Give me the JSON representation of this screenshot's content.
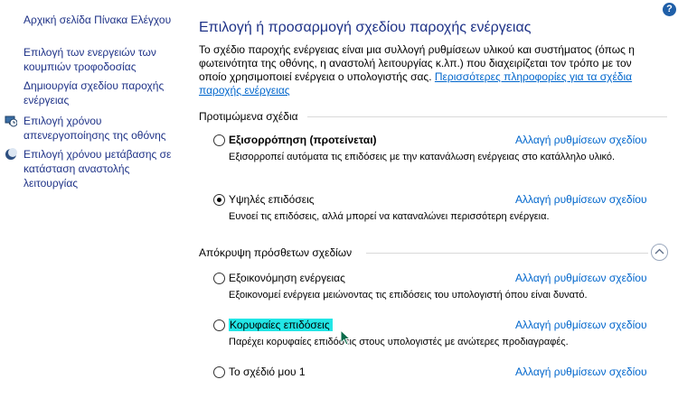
{
  "sidebar": {
    "home": "Αρχική σελίδα Πίνακα Ελέγχου",
    "items": [
      {
        "label": "Επιλογή των ενεργειών των κουμπιών τροφοδοσίας",
        "icon": "none"
      },
      {
        "label": "Δημιουργία σχεδίου παροχής ενέργειας",
        "icon": "none"
      },
      {
        "label": "Επιλογή χρόνου απενεργοποίησης της οθόνης",
        "icon": "monitor-clock-icon"
      },
      {
        "label": "Επιλογή χρόνου μετάβασης σε κατάσταση αναστολής λειτουργίας",
        "icon": "moon-icon"
      }
    ]
  },
  "help": "?",
  "main": {
    "title": "Επιλογή ή προσαρμογή σχεδίου παροχής ενέργειας",
    "description": "Το σχέδιο παροχής ενέργειας είναι μια συλλογή ρυθμίσεων υλικού και συστήματος (όπως η φωτεινότητα της οθόνης, η αναστολή λειτουργίας κ.λπ.) που διαχειρίζεται τον τρόπο με τον οποίο χρησιμοποιεί ενέργεια ο υπολογιστής σας. ",
    "more_link": "Περισσότερες πληροφορίες για τα σχέδια παροχής ενέργειας",
    "preferred_header": "Προτιμώμενα σχέδια",
    "hidden_header": "Απόκρυψη πρόσθετων σχεδίων",
    "change_label": "Αλλαγή ρυθμίσεων σχεδίου",
    "plans": [
      {
        "name": "Εξισορρόπηση (προτείνεται)",
        "desc": "Εξισορροπεί αυτόματα τις επιδόσεις με την κατανάλωση ενέργειας στο κατάλληλο υλικό.",
        "checked": false
      },
      {
        "name": "Υψηλές επιδόσεις",
        "desc": "Ευνοεί τις επιδόσεις, αλλά μπορεί να καταναλώνει περισσότερη ενέργεια.",
        "checked": true
      },
      {
        "name": "Εξοικονόμηση ενέργειας",
        "desc": "Εξοικονομεί ενέργεια μειώνοντας τις επιδόσεις του υπολογιστή όπου είναι δυνατό.",
        "checked": false
      },
      {
        "name": "Κορυφαίες επιδόσεις",
        "desc": "Παρέχει κορυφαίες επιδόσεις στους υπολογιστές με ανώτερες προδιαγραφές.",
        "checked": false
      },
      {
        "name": "Το σχέδιό μου 1",
        "desc": "",
        "checked": false
      }
    ]
  },
  "colors": {
    "link": "#0066cc",
    "nav": "#1e3287",
    "highlight": "#22e6e6"
  }
}
